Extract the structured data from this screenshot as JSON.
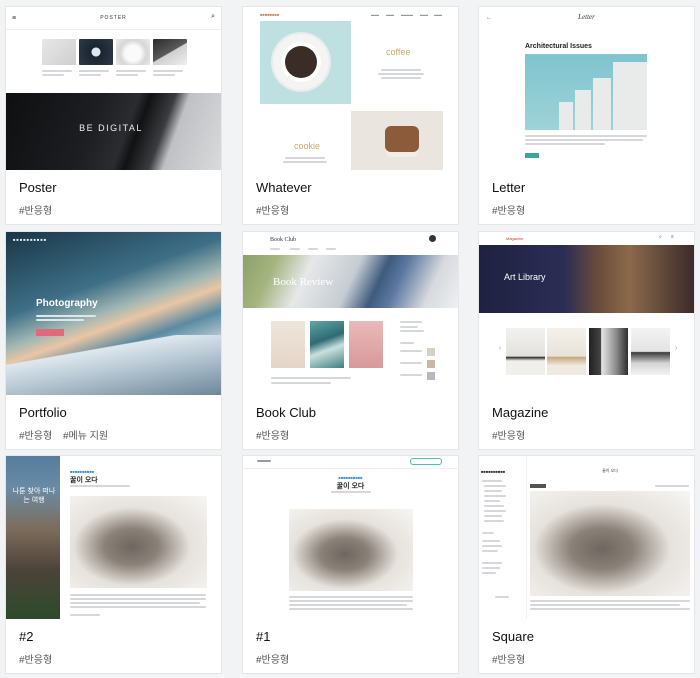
{
  "cards": [
    {
      "title": "Poster",
      "tags": [
        "#반응형"
      ],
      "thumb": {
        "logo": "POSTER",
        "hero_text": "BE DIGITAL"
      }
    },
    {
      "title": "Whatever",
      "tags": [
        "#반응형"
      ],
      "thumb": {
        "word_1": "coffee",
        "word_2": "cookie"
      }
    },
    {
      "title": "Letter",
      "tags": [
        "#반응형"
      ],
      "thumb": {
        "logo": "Letter",
        "post_title": "Architectural Issues"
      }
    },
    {
      "title": "Portfolio",
      "tags": [
        "#반응형",
        "#메뉴 지원"
      ],
      "thumb": {
        "hero_text": "Photography"
      }
    },
    {
      "title": "Book Club",
      "tags": [
        "#반응형"
      ],
      "thumb": {
        "logo": "Book Club",
        "hero_text": "Book Review"
      }
    },
    {
      "title": "Magazine",
      "tags": [
        "#반응형"
      ],
      "thumb": {
        "logo": "Magazine",
        "hero_text": "Art Library"
      }
    },
    {
      "title": "#2",
      "tags": [
        "#반응형"
      ],
      "thumb": {
        "side_text": "나툰 찾아 떠나 는 여행",
        "post_title": "꿀이 오다"
      }
    },
    {
      "title": "#1",
      "tags": [
        "#반응형"
      ],
      "thumb": {
        "post_title": "꿀이 오다"
      }
    },
    {
      "title": "Square",
      "tags": [
        "#반응형"
      ],
      "thumb": {
        "post_title": "꿀이 오다"
      }
    }
  ]
}
